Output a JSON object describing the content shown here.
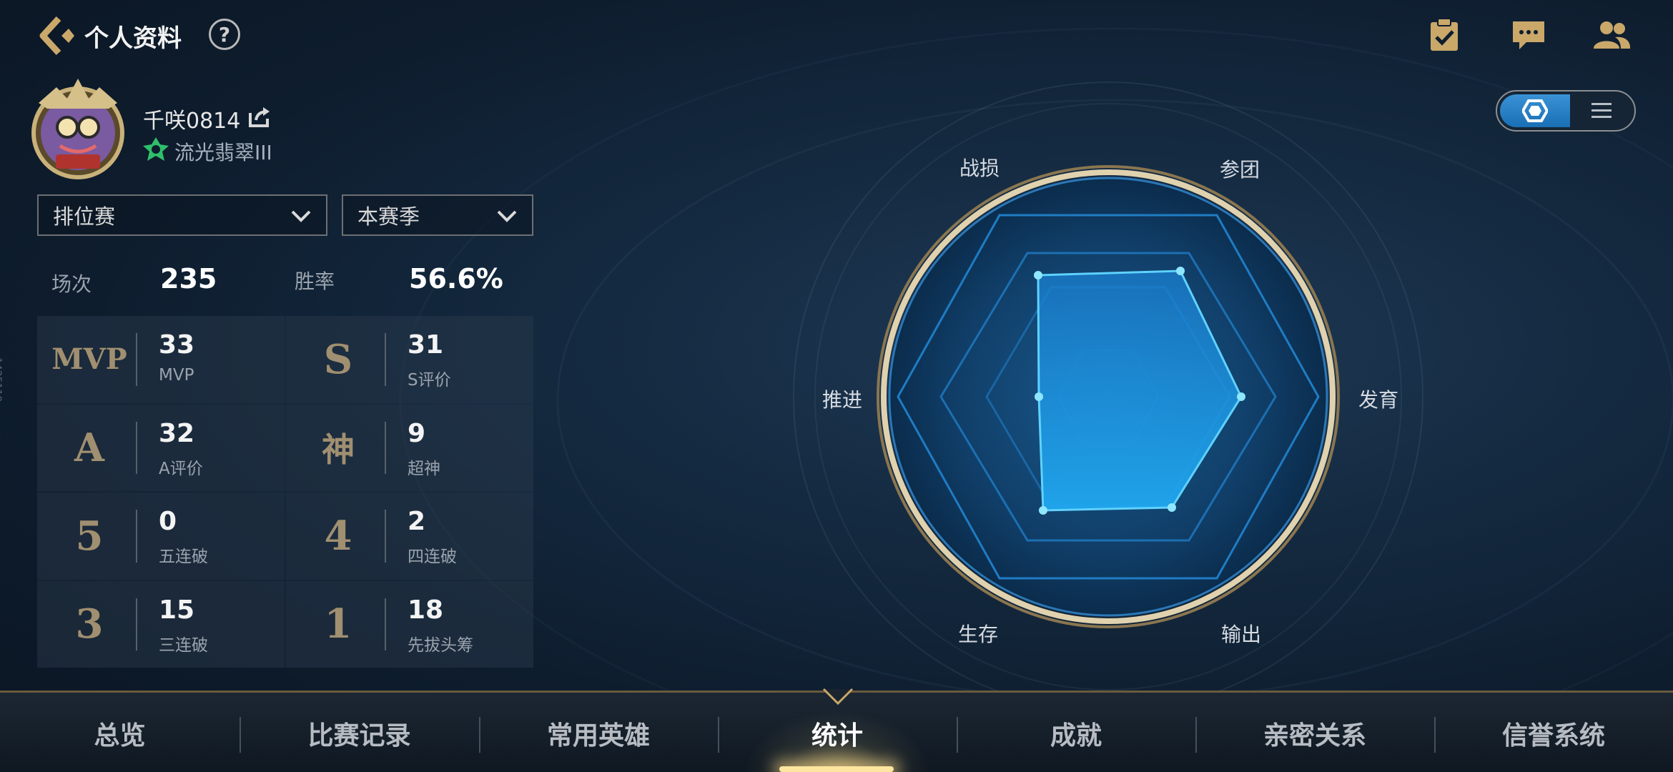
{
  "header": {
    "title": "个人资料",
    "help_symbol": "?",
    "back_icon": "back-arrow-icon",
    "icons": [
      "clipboard-check-icon",
      "chat-bubble-icon",
      "friends-icon"
    ]
  },
  "profile": {
    "username": "千咲0814",
    "rank": "流光翡翠III",
    "share_icon": "share-icon"
  },
  "filters": {
    "mode": "排位赛",
    "season": "本赛季"
  },
  "summary": {
    "games_label": "场次",
    "games_value": "235",
    "winrate_label": "胜率",
    "winrate_value": "56.6%"
  },
  "stats": [
    {
      "badge": "MVP",
      "value": "33",
      "label": "MVP"
    },
    {
      "badge": "S",
      "value": "31",
      "label": "S评价"
    },
    {
      "badge": "A",
      "value": "32",
      "label": "A评价"
    },
    {
      "badge": "神",
      "value": "9",
      "label": "超神"
    },
    {
      "badge": "5",
      "value": "0",
      "label": "五连破"
    },
    {
      "badge": "4",
      "value": "2",
      "label": "四连破"
    },
    {
      "badge": "3",
      "value": "15",
      "label": "三连破"
    },
    {
      "badge": "1",
      "value": "18",
      "label": "先拔头筹"
    }
  ],
  "radar": {
    "labels": {
      "top_left": "战损",
      "top_right": "参团",
      "right": "发育",
      "bottom_right": "输出",
      "bottom_left": "生存",
      "left": "推进"
    }
  },
  "view_toggle": {
    "active": "radar-view",
    "icons": [
      "hexagon-icon",
      "list-icon"
    ]
  },
  "side_id": "1425119",
  "tabs": [
    "总览",
    "比赛记录",
    "常用英雄",
    "统计",
    "成就",
    "亲密关系",
    "信誉系统"
  ],
  "active_tab": "统计",
  "colors": {
    "accent_gold": "#c9a86a",
    "radar_blue": "#1fa0ff",
    "bg": "#0e1d2e"
  }
}
